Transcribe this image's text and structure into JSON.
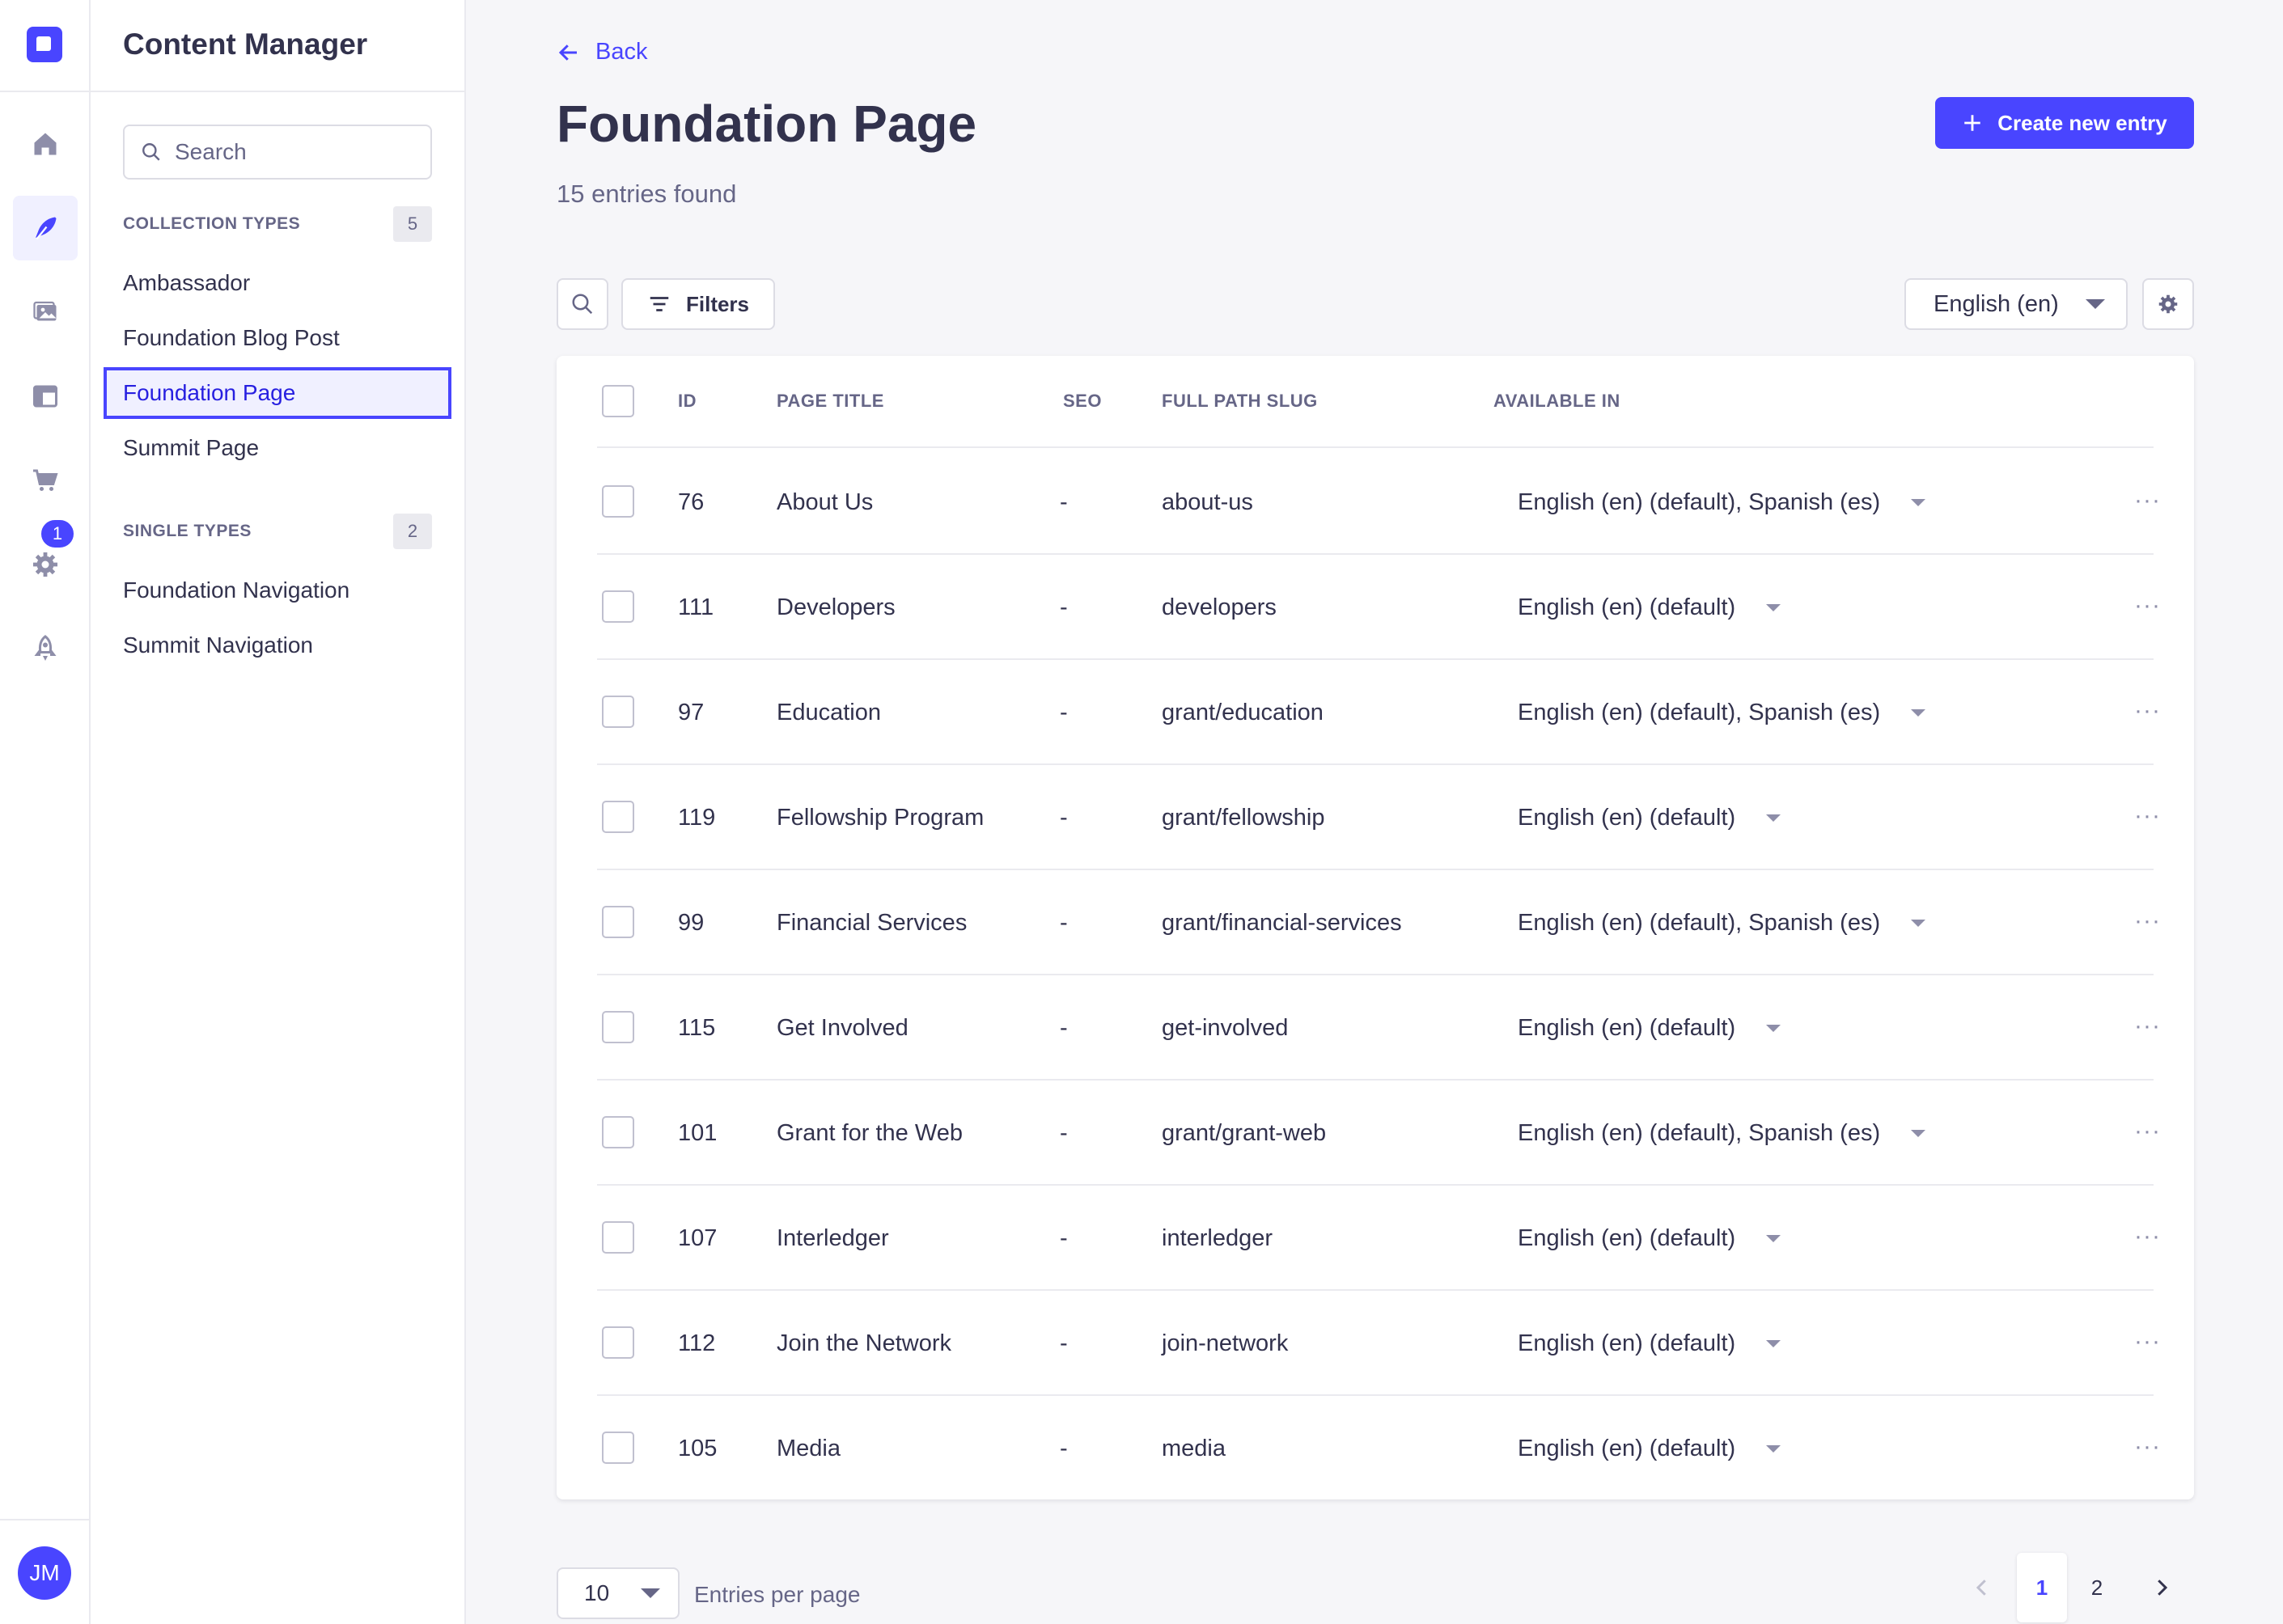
{
  "app": {
    "title": "Content Manager"
  },
  "colors": {
    "accent": "#4945ff",
    "text": "#32324d",
    "muted": "#666687",
    "background": "#f6f6f9"
  },
  "rail": {
    "icons": [
      "home-icon",
      "content-manager-icon",
      "media-library-icon",
      "content-type-builder-icon",
      "marketplace-icon",
      "settings-icon",
      "deployment-icon"
    ],
    "settings_badge": "1",
    "avatar_initials": "JM"
  },
  "subnav": {
    "search_placeholder": "Search",
    "collection_types": {
      "label": "COLLECTION TYPES",
      "count": "5",
      "items": [
        "Ambassador",
        "Foundation Blog Post",
        "Foundation Page",
        "Summit Page"
      ],
      "active": "Foundation Page"
    },
    "single_types": {
      "label": "SINGLE TYPES",
      "count": "2",
      "items": [
        "Foundation Navigation",
        "Summit Navigation"
      ]
    }
  },
  "main": {
    "back_label": "Back",
    "title": "Foundation Page",
    "entries_found": "15 entries found",
    "create_label": "Create new entry",
    "filters_label": "Filters",
    "locale": "English (en)"
  },
  "table": {
    "headers": {
      "id": "ID",
      "page_title": "PAGE TITLE",
      "seo": "SEO",
      "slug": "FULL PATH SLUG",
      "available_in": "AVAILABLE IN"
    },
    "rows": [
      {
        "id": "76",
        "title": "About Us",
        "seo": "-",
        "slug": "about-us",
        "available": "English (en) (default), Spanish (es)",
        "more": "···"
      },
      {
        "id": "111",
        "title": "Developers",
        "seo": "-",
        "slug": "developers",
        "available": "English (en) (default)",
        "more": "···"
      },
      {
        "id": "97",
        "title": "Education",
        "seo": "-",
        "slug": "grant/education",
        "available": "English (en) (default), Spanish (es)",
        "more": "···"
      },
      {
        "id": "119",
        "title": "Fellowship Program",
        "seo": "-",
        "slug": "grant/fellowship",
        "available": "English (en) (default)",
        "more": "···"
      },
      {
        "id": "99",
        "title": "Financial Services",
        "seo": "-",
        "slug": "grant/financial-services",
        "available": "English (en) (default), Spanish (es)",
        "more": "···"
      },
      {
        "id": "115",
        "title": "Get Involved",
        "seo": "-",
        "slug": "get-involved",
        "available": "English (en) (default)",
        "more": "···"
      },
      {
        "id": "101",
        "title": "Grant for the Web",
        "seo": "-",
        "slug": "grant/grant-web",
        "available": "English (en) (default), Spanish (es)",
        "more": "···"
      },
      {
        "id": "107",
        "title": "Interledger",
        "seo": "-",
        "slug": "interledger",
        "available": "English (en) (default)",
        "more": "···"
      },
      {
        "id": "112",
        "title": "Join the Network",
        "seo": "-",
        "slug": "join-network",
        "available": "English (en) (default)",
        "more": "···"
      },
      {
        "id": "105",
        "title": "Media",
        "seo": "-",
        "slug": "media",
        "available": "English (en) (default)",
        "more": "···"
      }
    ]
  },
  "footer": {
    "per_page_value": "10",
    "per_page_label": "Entries per page",
    "pages": [
      "1",
      "2"
    ],
    "current_page": "1"
  }
}
